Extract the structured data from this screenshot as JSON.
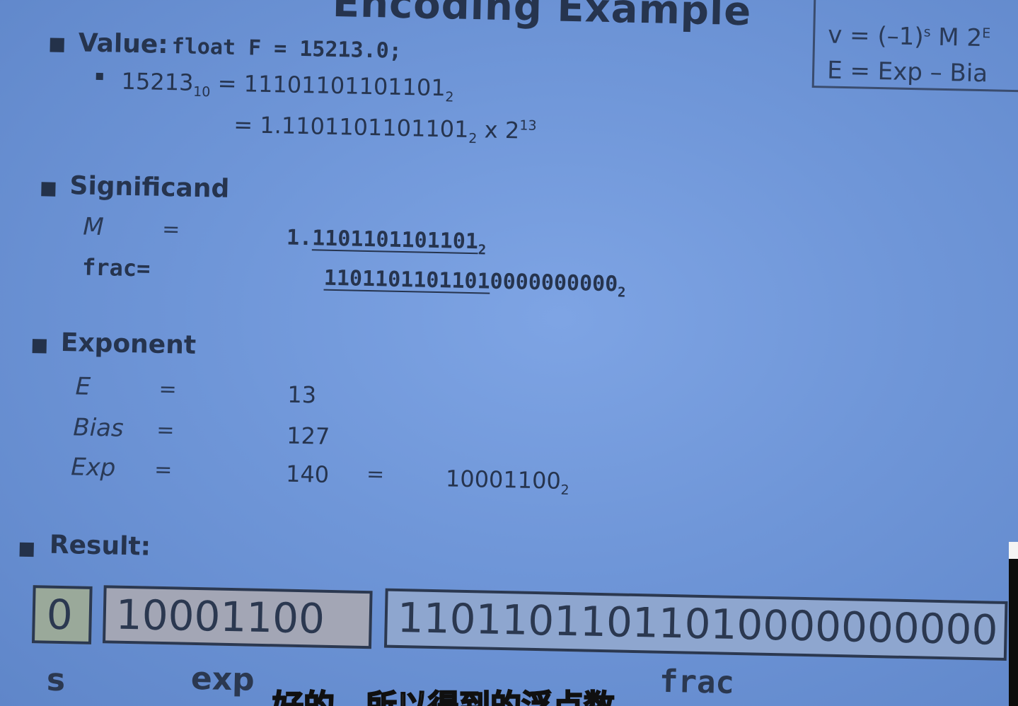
{
  "slide": {
    "title": "Encoding Example",
    "formula": {
      "line1": "v = (–1)",
      "line1_s": "s",
      "line1_rest": " M 2",
      "line1_e": "E",
      "line2": "E  =  Exp – Bia"
    },
    "value": {
      "label": "Value:",
      "code": "float F = 15213.0;",
      "dec_num": "15213",
      "dec_base": "10",
      "eq_bin": "= 11101101101101",
      "bin_base": "2",
      "eq_norm": "= 1.1101101101101",
      "norm_base": "2",
      "times": " x 2",
      "exp13": "13"
    },
    "significand": {
      "heading": "Significand",
      "m_label": "M",
      "m_eq": "=",
      "m_lead": "1.",
      "m_digits": "1101101101101",
      "m_base": "2",
      "frac_label": "frac=",
      "frac_digits_u": "1101101101101",
      "frac_digits_rest": "0000000000",
      "frac_base": "2"
    },
    "exponent": {
      "heading": "Exponent",
      "rows": [
        {
          "label": "E",
          "eq": "=",
          "value": "13"
        },
        {
          "label": "Bias",
          "eq": "=",
          "value": "127"
        },
        {
          "label": "Exp",
          "eq": "=",
          "value": "140"
        }
      ],
      "exp_eq2": "=",
      "exp_bin": "10001100",
      "exp_bin_base": "2"
    },
    "result": {
      "heading": "Result:",
      "s_bit": "0",
      "exp_bits": "10001100",
      "frac_bits": "11011011011010000000000",
      "s_label": "s",
      "exp_label": "exp",
      "frac_label": "frac"
    }
  },
  "subtitle": "好的，所以得到的浮点数"
}
